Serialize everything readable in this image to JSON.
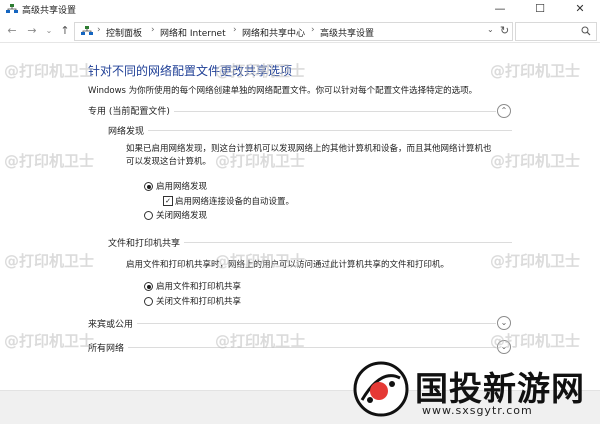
{
  "window": {
    "title": "高级共享设置"
  },
  "nav": {
    "breadcrumbs": [
      "控制面板",
      "网络和 Internet",
      "网络和共享中心",
      "高级共享设置"
    ]
  },
  "main": {
    "heading": "针对不同的网络配置文件更改共享选项",
    "description": "Windows 为你所使用的每个网络创建单独的网络配置文件。你可以针对每个配置文件选择特定的选项。",
    "profiles": {
      "private": {
        "label": "专用 (当前配置文件)",
        "expanded": true,
        "discovery": {
          "title": "网络发现",
          "text_line1": "如果已启用网络发现，则这台计算机可以发现网络上的其他计算机和设备，而且其他网络计算机也",
          "text_line2": "可以发现这台计算机。",
          "on_label": "启用网络发现",
          "auto_setup_label": "启用网络连接设备的自动设置。",
          "off_label": "关闭网络发现",
          "selected": "on",
          "auto_setup_checked": true
        },
        "sharing": {
          "title": "文件和打印机共享",
          "text": "启用文件和打印机共享时，网络上的用户可以访问通过此计算机共享的文件和打印机。",
          "on_label": "启用文件和打印机共享",
          "off_label": "关闭文件和打印机共享",
          "selected": "on"
        }
      },
      "guest": {
        "label": "来宾或公用",
        "expanded": false
      },
      "all": {
        "label": "所有网络",
        "expanded": false
      }
    }
  },
  "watermark": {
    "text": "@打印机卫士",
    "brand_name": "国投新游网",
    "brand_url": "www.sxsgytr.com"
  },
  "colors": {
    "heading": "#1f3f96",
    "footer": "#f0f0f0"
  },
  "icons": [
    "network-icon",
    "back-arrow-icon",
    "forward-arrow-icon",
    "up-arrow-icon",
    "refresh-icon",
    "search-icon",
    "chevron-up-icon",
    "chevron-down-icon"
  ]
}
